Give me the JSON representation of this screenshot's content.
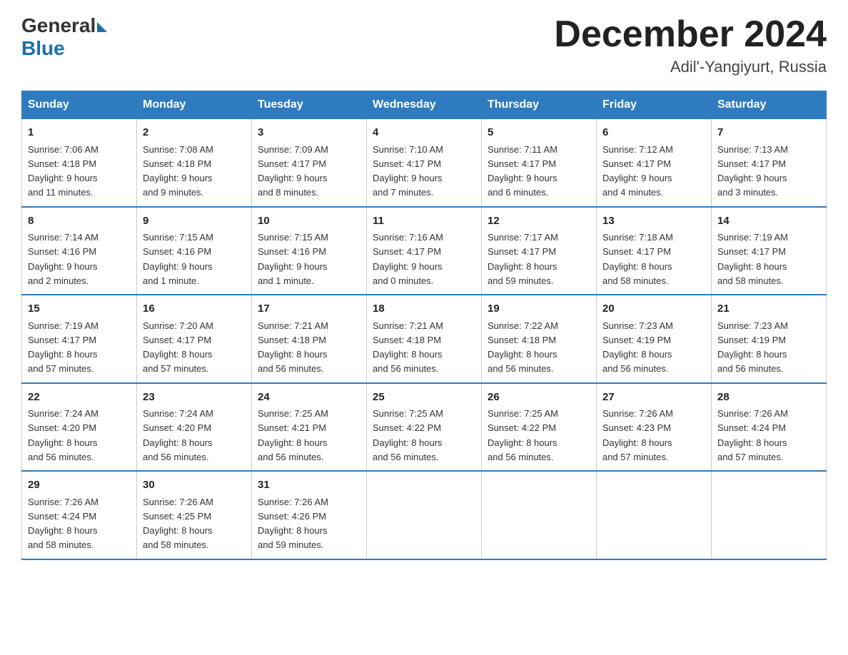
{
  "logo": {
    "general": "General",
    "blue": "Blue"
  },
  "header": {
    "month_year": "December 2024",
    "location": "Adil'-Yangiyurt, Russia"
  },
  "days_of_week": [
    "Sunday",
    "Monday",
    "Tuesday",
    "Wednesday",
    "Thursday",
    "Friday",
    "Saturday"
  ],
  "weeks": [
    [
      {
        "day": "1",
        "sunrise": "7:06 AM",
        "sunset": "4:18 PM",
        "daylight": "9 hours and 11 minutes."
      },
      {
        "day": "2",
        "sunrise": "7:08 AM",
        "sunset": "4:18 PM",
        "daylight": "9 hours and 9 minutes."
      },
      {
        "day": "3",
        "sunrise": "7:09 AM",
        "sunset": "4:17 PM",
        "daylight": "9 hours and 8 minutes."
      },
      {
        "day": "4",
        "sunrise": "7:10 AM",
        "sunset": "4:17 PM",
        "daylight": "9 hours and 7 minutes."
      },
      {
        "day": "5",
        "sunrise": "7:11 AM",
        "sunset": "4:17 PM",
        "daylight": "9 hours and 6 minutes."
      },
      {
        "day": "6",
        "sunrise": "7:12 AM",
        "sunset": "4:17 PM",
        "daylight": "9 hours and 4 minutes."
      },
      {
        "day": "7",
        "sunrise": "7:13 AM",
        "sunset": "4:17 PM",
        "daylight": "9 hours and 3 minutes."
      }
    ],
    [
      {
        "day": "8",
        "sunrise": "7:14 AM",
        "sunset": "4:16 PM",
        "daylight": "9 hours and 2 minutes."
      },
      {
        "day": "9",
        "sunrise": "7:15 AM",
        "sunset": "4:16 PM",
        "daylight": "9 hours and 1 minute."
      },
      {
        "day": "10",
        "sunrise": "7:15 AM",
        "sunset": "4:16 PM",
        "daylight": "9 hours and 1 minute."
      },
      {
        "day": "11",
        "sunrise": "7:16 AM",
        "sunset": "4:17 PM",
        "daylight": "9 hours and 0 minutes."
      },
      {
        "day": "12",
        "sunrise": "7:17 AM",
        "sunset": "4:17 PM",
        "daylight": "8 hours and 59 minutes."
      },
      {
        "day": "13",
        "sunrise": "7:18 AM",
        "sunset": "4:17 PM",
        "daylight": "8 hours and 58 minutes."
      },
      {
        "day": "14",
        "sunrise": "7:19 AM",
        "sunset": "4:17 PM",
        "daylight": "8 hours and 58 minutes."
      }
    ],
    [
      {
        "day": "15",
        "sunrise": "7:19 AM",
        "sunset": "4:17 PM",
        "daylight": "8 hours and 57 minutes."
      },
      {
        "day": "16",
        "sunrise": "7:20 AM",
        "sunset": "4:17 PM",
        "daylight": "8 hours and 57 minutes."
      },
      {
        "day": "17",
        "sunrise": "7:21 AM",
        "sunset": "4:18 PM",
        "daylight": "8 hours and 56 minutes."
      },
      {
        "day": "18",
        "sunrise": "7:21 AM",
        "sunset": "4:18 PM",
        "daylight": "8 hours and 56 minutes."
      },
      {
        "day": "19",
        "sunrise": "7:22 AM",
        "sunset": "4:18 PM",
        "daylight": "8 hours and 56 minutes."
      },
      {
        "day": "20",
        "sunrise": "7:23 AM",
        "sunset": "4:19 PM",
        "daylight": "8 hours and 56 minutes."
      },
      {
        "day": "21",
        "sunrise": "7:23 AM",
        "sunset": "4:19 PM",
        "daylight": "8 hours and 56 minutes."
      }
    ],
    [
      {
        "day": "22",
        "sunrise": "7:24 AM",
        "sunset": "4:20 PM",
        "daylight": "8 hours and 56 minutes."
      },
      {
        "day": "23",
        "sunrise": "7:24 AM",
        "sunset": "4:20 PM",
        "daylight": "8 hours and 56 minutes."
      },
      {
        "day": "24",
        "sunrise": "7:25 AM",
        "sunset": "4:21 PM",
        "daylight": "8 hours and 56 minutes."
      },
      {
        "day": "25",
        "sunrise": "7:25 AM",
        "sunset": "4:22 PM",
        "daylight": "8 hours and 56 minutes."
      },
      {
        "day": "26",
        "sunrise": "7:25 AM",
        "sunset": "4:22 PM",
        "daylight": "8 hours and 56 minutes."
      },
      {
        "day": "27",
        "sunrise": "7:26 AM",
        "sunset": "4:23 PM",
        "daylight": "8 hours and 57 minutes."
      },
      {
        "day": "28",
        "sunrise": "7:26 AM",
        "sunset": "4:24 PM",
        "daylight": "8 hours and 57 minutes."
      }
    ],
    [
      {
        "day": "29",
        "sunrise": "7:26 AM",
        "sunset": "4:24 PM",
        "daylight": "8 hours and 58 minutes."
      },
      {
        "day": "30",
        "sunrise": "7:26 AM",
        "sunset": "4:25 PM",
        "daylight": "8 hours and 58 minutes."
      },
      {
        "day": "31",
        "sunrise": "7:26 AM",
        "sunset": "4:26 PM",
        "daylight": "8 hours and 59 minutes."
      },
      null,
      null,
      null,
      null
    ]
  ],
  "labels": {
    "sunrise": "Sunrise:",
    "sunset": "Sunset:",
    "daylight": "Daylight:"
  }
}
